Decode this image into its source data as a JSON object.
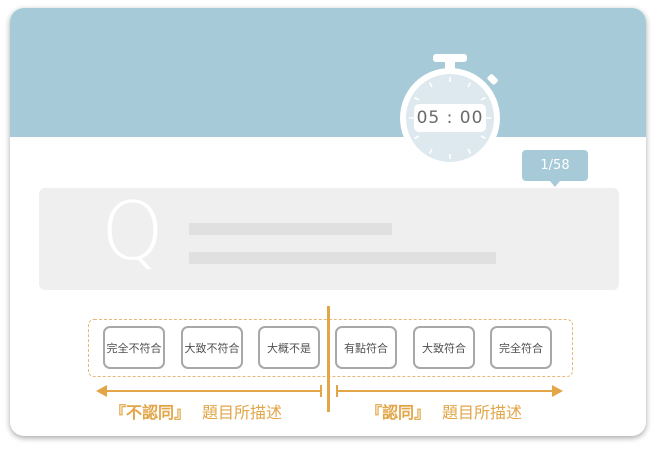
{
  "timer": {
    "display": "05 : 00"
  },
  "progress": {
    "label": "1/58"
  },
  "question": {
    "icon_letter": "Q"
  },
  "options": [
    {
      "label": "完全不符合"
    },
    {
      "label": "大致不符合"
    },
    {
      "label": "大概不是"
    },
    {
      "label": "有點符合"
    },
    {
      "label": "大致符合"
    },
    {
      "label": "完全符合"
    }
  ],
  "captions": {
    "disagree_quote": "『不認同』",
    "disagree_rest": "題目所描述",
    "agree_quote": "『認同』",
    "agree_rest": "題目所描述"
  },
  "colors": {
    "header": "#a6cad8",
    "accent": "#e2a547",
    "question_bg": "#efefef"
  }
}
